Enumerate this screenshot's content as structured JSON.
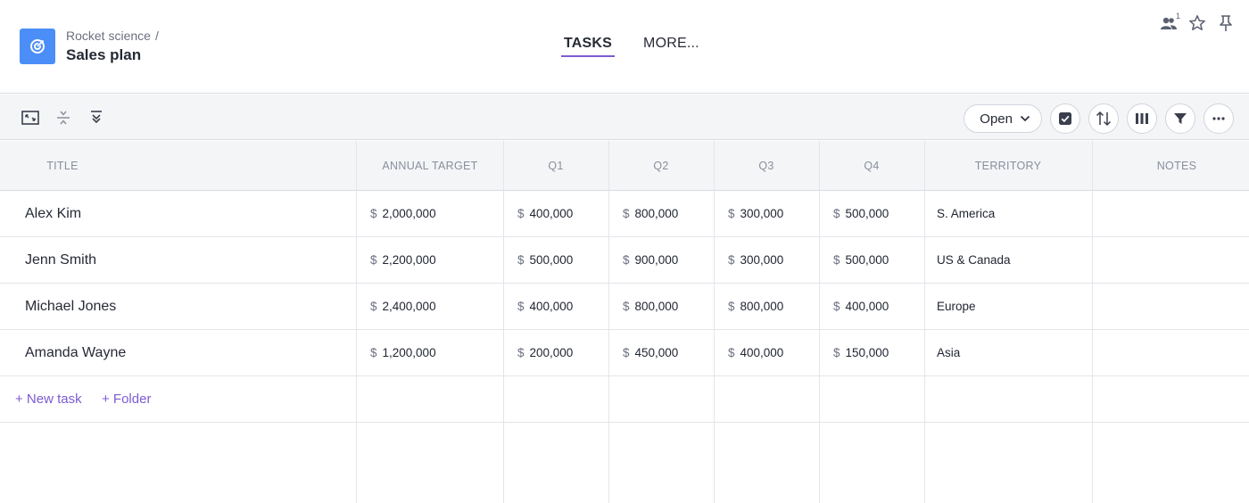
{
  "header": {
    "breadcrumb": "Rocket science",
    "breadcrumb_sep": "/",
    "title": "Sales plan",
    "app_icon": "target-icon",
    "tabs": [
      {
        "label": "TASKS",
        "active": true
      },
      {
        "label": "MORE..."
      }
    ],
    "members_count": "1",
    "icons": [
      "members-icon",
      "star-icon",
      "pin-icon"
    ]
  },
  "toolbar": {
    "left_icons": [
      "expand-icon",
      "collapse-icon",
      "expand-all-icon"
    ],
    "status_filter": "Open",
    "right_icons": [
      "checkbox-icon",
      "sort-icon",
      "columns-icon",
      "filter-icon",
      "more-icon"
    ]
  },
  "table": {
    "columns": [
      "TITLE",
      "ANNUAL TARGET",
      "Q1",
      "Q2",
      "Q3",
      "Q4",
      "TERRITORY",
      "NOTES"
    ],
    "currency": "$",
    "rows": [
      {
        "title": "Alex Kim",
        "annual": "2,000,000",
        "q1": "400,000",
        "q2": "800,000",
        "q3": "300,000",
        "q4": "500,000",
        "territory": "S. America",
        "notes": ""
      },
      {
        "title": "Jenn Smith",
        "annual": "2,200,000",
        "q1": "500,000",
        "q2": "900,000",
        "q3": "300,000",
        "q4": "500,000",
        "territory": "US & Canada",
        "notes": ""
      },
      {
        "title": "Michael Jones",
        "annual": "2,400,000",
        "q1": "400,000",
        "q2": "800,000",
        "q3": "800,000",
        "q4": "400,000",
        "territory": "Europe",
        "notes": ""
      },
      {
        "title": "Amanda Wayne",
        "annual": "1,200,000",
        "q1": "200,000",
        "q2": "450,000",
        "q3": "400,000",
        "q4": "150,000",
        "territory": "Asia",
        "notes": ""
      }
    ],
    "new_task_label": "+ New task",
    "new_folder_label": "+ Folder"
  },
  "colors": {
    "accent": "#7e5bd1",
    "app_icon_bg": "#4b8ef7"
  }
}
